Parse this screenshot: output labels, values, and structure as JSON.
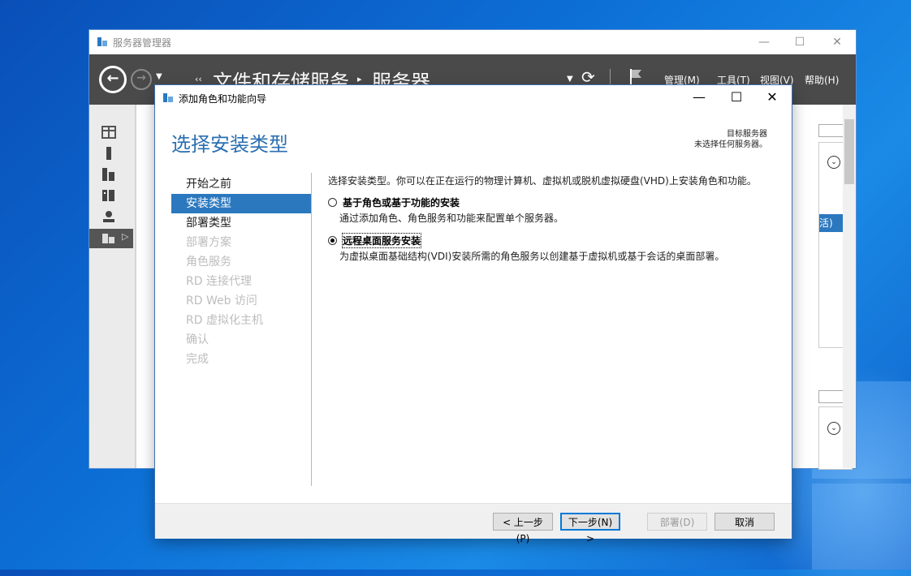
{
  "server_manager": {
    "title": "服务器管理器",
    "breadcrumb": [
      "文件和存储服务",
      "服务器"
    ],
    "menu": [
      "管理(M)",
      "工具(T)",
      "视图(V)",
      "帮助(H)"
    ],
    "peek_text": "活)"
  },
  "dialog": {
    "title": "添加角色和功能向导",
    "heading": "选择安装类型",
    "target_server_label": "目标服务器",
    "target_server_value": "未选择任何服务器。",
    "steps": [
      {
        "label": "开始之前",
        "state": "normal"
      },
      {
        "label": "安装类型",
        "state": "active"
      },
      {
        "label": "部署类型",
        "state": "normal"
      },
      {
        "label": "部署方案",
        "state": "disabled"
      },
      {
        "label": "角色服务",
        "state": "disabled"
      },
      {
        "label": "RD 连接代理",
        "state": "disabled"
      },
      {
        "label": "RD Web 访问",
        "state": "disabled"
      },
      {
        "label": "RD 虚拟化主机",
        "state": "disabled"
      },
      {
        "label": "确认",
        "state": "disabled"
      },
      {
        "label": "完成",
        "state": "disabled"
      }
    ],
    "intro": "选择安装类型。你可以在正在运行的物理计算机、虚拟机或脱机虚拟硬盘(VHD)上安装角色和功能。",
    "options": [
      {
        "label": "基于角色或基于功能的安装",
        "desc": "通过添加角色、角色服务和功能来配置单个服务器。",
        "selected": false
      },
      {
        "label": "远程桌面服务安装",
        "desc": "为虚拟桌面基础结构(VDI)安装所需的角色服务以创建基于虚拟机或基于会话的桌面部署。",
        "selected": true
      }
    ],
    "buttons": {
      "prev": "< 上一步(P)",
      "next": "下一步(N) >",
      "deploy": "部署(D)",
      "cancel": "取消"
    }
  },
  "colors": {
    "accent": "#2b78bf",
    "heading": "#2b6fb0",
    "header_bg": "#4a4a4a"
  }
}
